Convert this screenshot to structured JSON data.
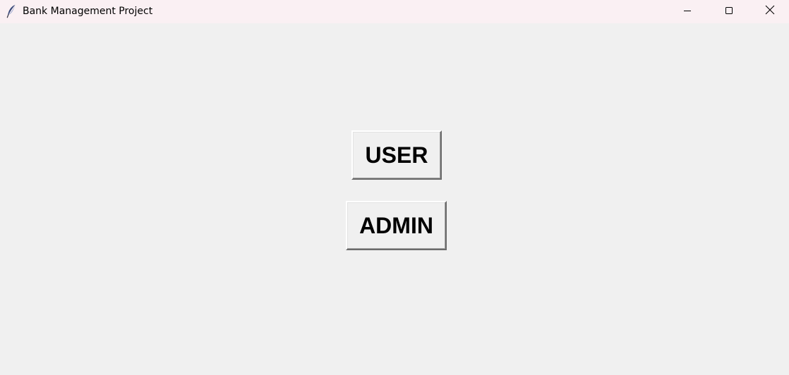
{
  "window": {
    "title": "Bank Management Project",
    "icon": "feather-icon",
    "controls": {
      "minimize": "minimize-icon",
      "maximize": "maximize-icon",
      "close": "close-icon"
    }
  },
  "main": {
    "user_button_label": "USER",
    "admin_button_label": "ADMIN"
  },
  "colors": {
    "titlebar_bg": "#faf0f3",
    "window_bg": "#f0f0f0",
    "text": "#000000"
  }
}
